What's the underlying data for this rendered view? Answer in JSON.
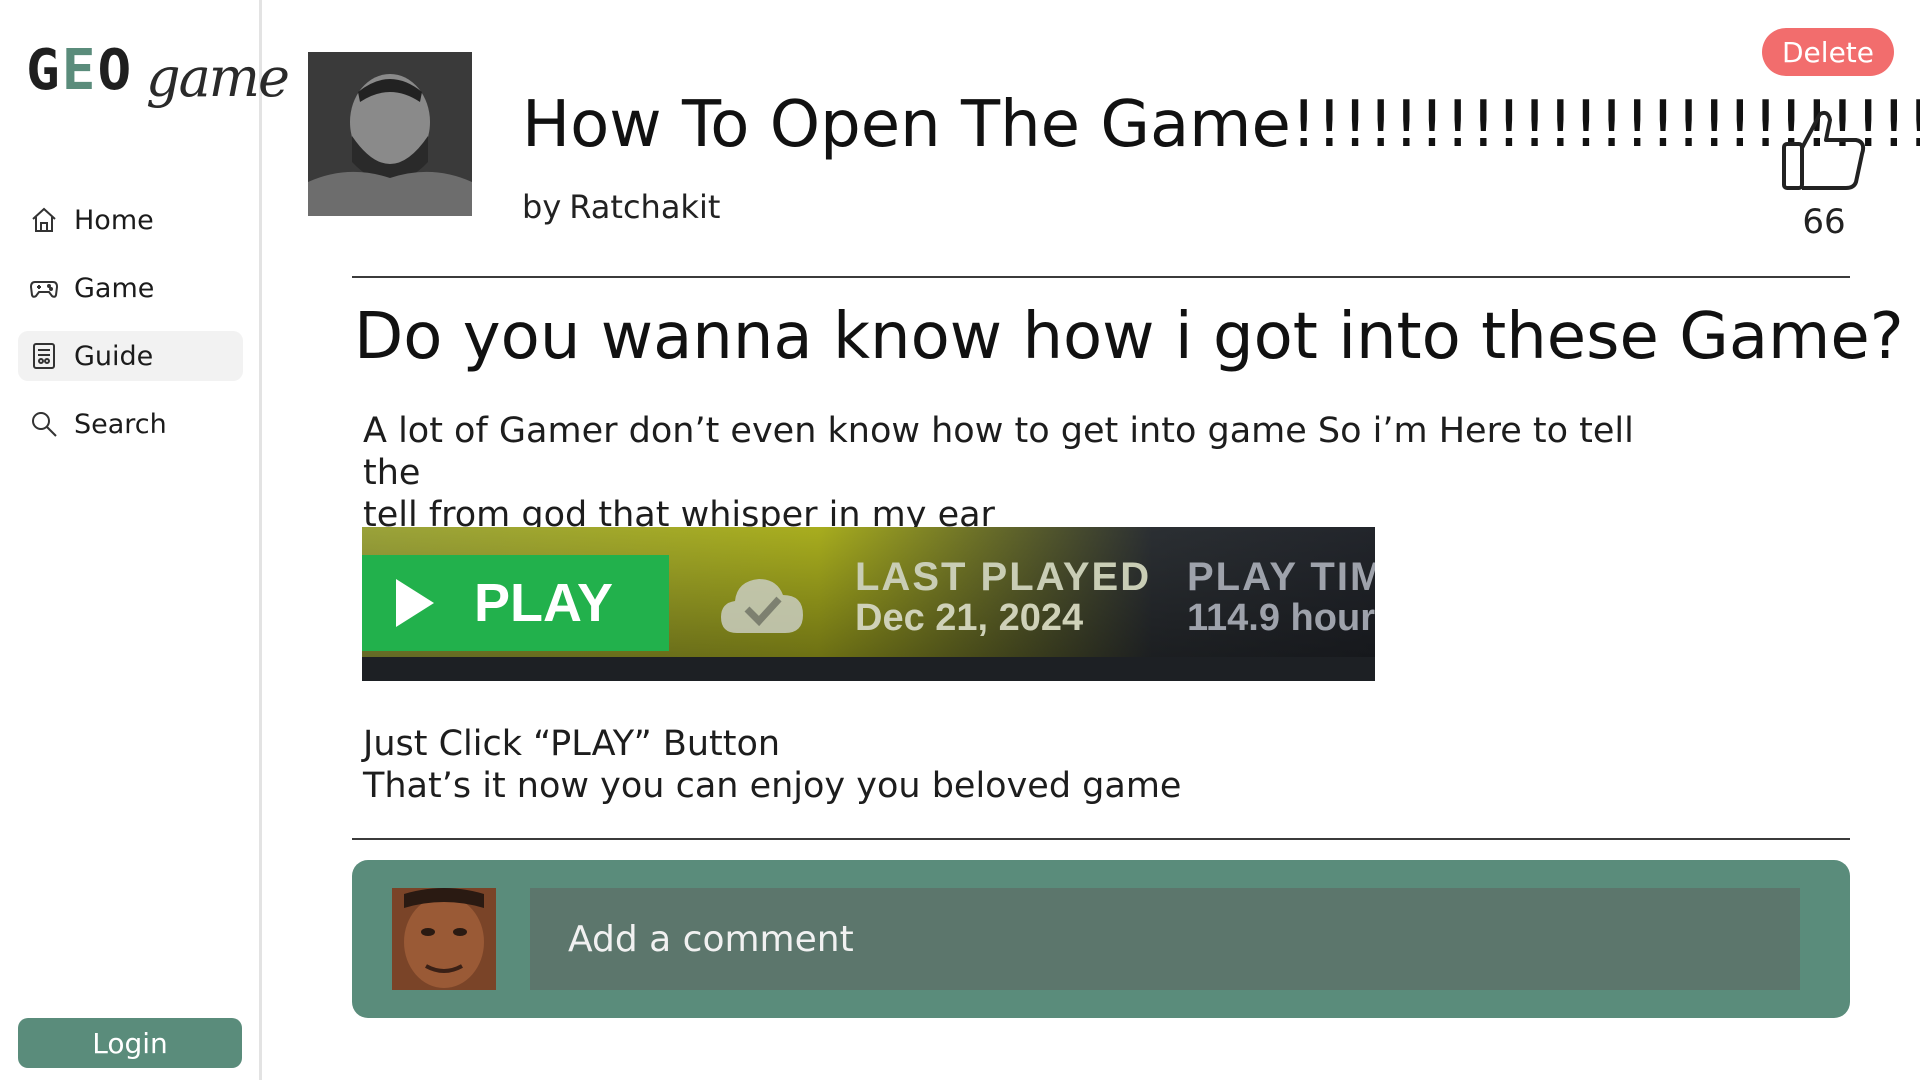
{
  "brand": {
    "geo_prefix": "G",
    "geo_accent": "E",
    "geo_suffix": "O",
    "game": "game",
    "accent_color": "#5a8c7b"
  },
  "sidebar": {
    "items": [
      {
        "label": "Home",
        "icon": "home-icon"
      },
      {
        "label": "Game",
        "icon": "gamepad-icon"
      },
      {
        "label": "Guide",
        "icon": "guide-icon",
        "active": true
      },
      {
        "label": "Search",
        "icon": "search-icon"
      }
    ],
    "login_label": "Login"
  },
  "post": {
    "title": "How To Open The Game!!!!!!!!!!!!!!!!!!!!!!!!!",
    "by": "by",
    "author": "Ratchakit",
    "delete_label": "Delete",
    "like_count": "66",
    "heading": "Do you wanna know how i got into these Game?",
    "intro_line1": "A lot of Gamer don’t even know how to get into game So i’m Here to tell the",
    "intro_line2": "tell from god that whisper in my ear",
    "steps_line1": "Just Click “PLAY” Button",
    "steps_line2": "That’s it now you can enjoy you beloved game"
  },
  "screenshot": {
    "play_label": "PLAY",
    "last_played_label": "LAST PLAYED",
    "last_played_value": "Dec 21, 2024",
    "play_time_label": "PLAY TIM",
    "play_time_value": "114.9 hour"
  },
  "comment": {
    "placeholder": "Add a comment"
  },
  "colors": {
    "accent": "#5a8c7b",
    "danger": "#f26d6d",
    "play_green": "#22b14c",
    "comment_input": "#5c766c"
  }
}
